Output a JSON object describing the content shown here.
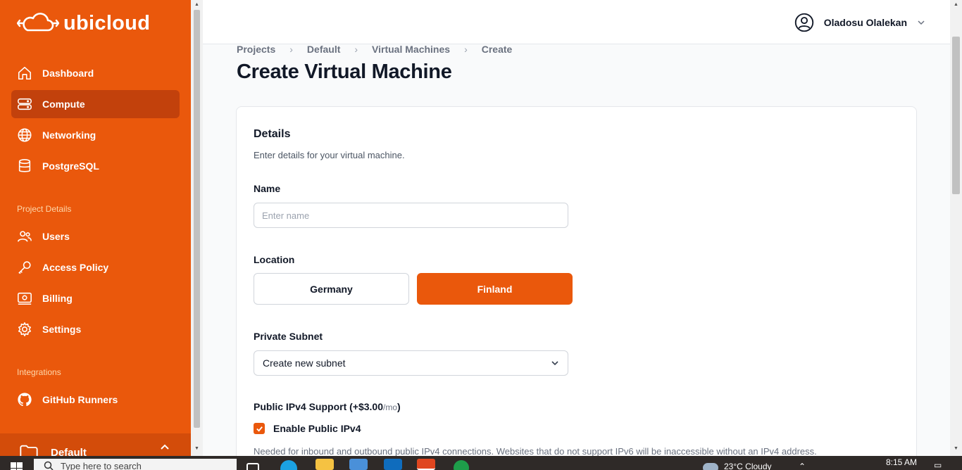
{
  "brand": {
    "name": "ubicloud"
  },
  "colors": {
    "accent": "#ea580c",
    "accent_dark": "#c2410c"
  },
  "sidebar": {
    "items": [
      {
        "label": "Dashboard",
        "icon": "home-icon"
      },
      {
        "label": "Compute",
        "icon": "server-icon",
        "active": true
      },
      {
        "label": "Networking",
        "icon": "globe-icon"
      },
      {
        "label": "PostgreSQL",
        "icon": "database-icon"
      }
    ],
    "project_section": "Project Details",
    "project_items": [
      {
        "label": "Users",
        "icon": "users-icon"
      },
      {
        "label": "Access Policy",
        "icon": "key-icon"
      },
      {
        "label": "Billing",
        "icon": "billing-icon"
      },
      {
        "label": "Settings",
        "icon": "gear-icon"
      }
    ],
    "integrations_section": "Integrations",
    "integration_items": [
      {
        "label": "GitHub Runners",
        "icon": "github-icon"
      }
    ],
    "project_switcher": "Default"
  },
  "header": {
    "user_name": "Oladosu Olalekan"
  },
  "breadcrumb": [
    "Projects",
    "Default",
    "Virtual Machines",
    "Create"
  ],
  "page": {
    "title": "Create Virtual Machine"
  },
  "form": {
    "section_title": "Details",
    "section_subtitle": "Enter details for your virtual machine.",
    "name_label": "Name",
    "name_placeholder": "Enter name",
    "location_label": "Location",
    "locations": [
      {
        "label": "Germany",
        "selected": false
      },
      {
        "label": "Finland",
        "selected": true
      }
    ],
    "subnet_label": "Private Subnet",
    "subnet_value": "Create new subnet",
    "ipv4_label": "Public IPv4 Support (+$3.00",
    "ipv4_unit": "/mo",
    "ipv4_close": ")",
    "ipv4_checkbox_label": "Enable Public IPv4",
    "ipv4_checked": true,
    "ipv4_help": "Needed for inbound and outbound public IPv4 connections. Websites that do not support IPv6 will be inaccessible without an IPv4 address."
  },
  "taskbar": {
    "search_placeholder": "Type here to search",
    "weather": "23°C  Cloudy",
    "time": "8:15 AM"
  }
}
